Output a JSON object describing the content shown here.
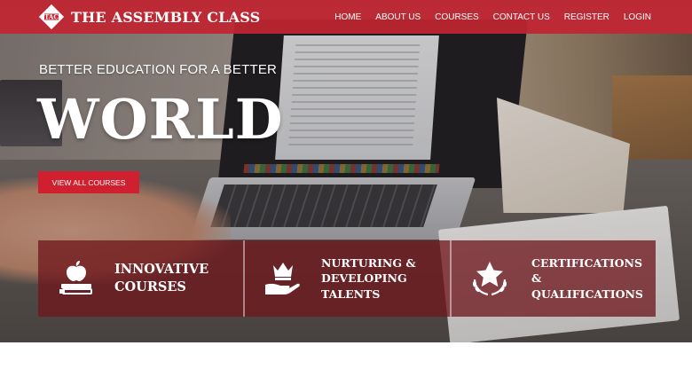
{
  "brand": {
    "logo_text": "TAC",
    "name": "THE ASSEMBLY CLASS"
  },
  "nav": {
    "items": [
      {
        "label": "HOME"
      },
      {
        "label": "ABOUT US"
      },
      {
        "label": "COURSES"
      },
      {
        "label": "CONTACT US"
      },
      {
        "label": "REGISTER"
      },
      {
        "label": "LOGIN"
      }
    ]
  },
  "hero": {
    "tagline": "BETTER EDUCATION FOR A BETTER",
    "headline": "WORLD",
    "cta_label": "VIEW ALL COURSES"
  },
  "features": [
    {
      "icon": "apple-books-icon",
      "lines": [
        "INNOVATIVE",
        "COURSES"
      ]
    },
    {
      "icon": "crown-hand-icon",
      "lines": [
        "NURTURING &",
        "DEVELOPING",
        "TALENTS"
      ]
    },
    {
      "icon": "star-laurel-icon",
      "lines": [
        "CERTIFICATIONS",
        "& QUALIFICATIONS"
      ]
    }
  ],
  "colors": {
    "navbar": "#c92632",
    "accent": "#d0202f",
    "feature_panel": "#6e161c",
    "text": "#ffffff"
  }
}
